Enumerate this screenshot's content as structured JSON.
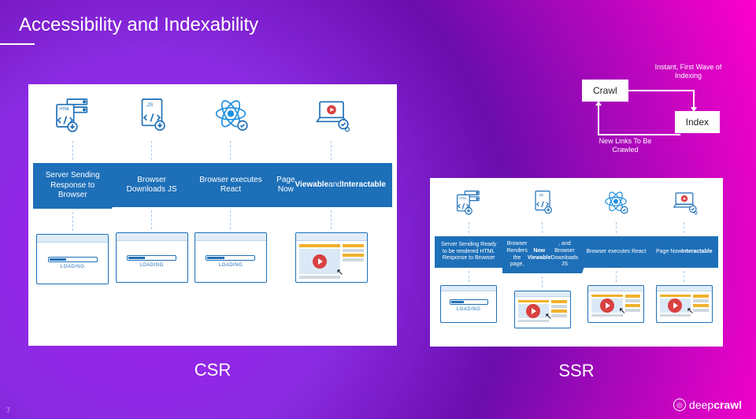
{
  "slide": {
    "title": "Accessibility and Indexability",
    "number": "7"
  },
  "brand": {
    "name_light": "deep",
    "name_bold": "crawl"
  },
  "crawl_index": {
    "top_label": "Instant, First Wave of Indexing",
    "box_crawl": "Crawl",
    "box_index": "Index",
    "bottom_label": "New Links To Be Crawled"
  },
  "csr": {
    "label": "CSR",
    "loading_text": "LOADING",
    "steps": [
      {
        "html": "Server Sending Response to Browser"
      },
      {
        "html": "Browser Downloads JS"
      },
      {
        "html": "Browser executes React"
      },
      {
        "html": "Page Now <b>Viewable</b> and <b>Interactable</b>"
      }
    ],
    "icons": [
      "html-doc",
      "js-doc",
      "react",
      "laptop"
    ],
    "bottoms": [
      "loading",
      "loading",
      "loading",
      "rich"
    ]
  },
  "ssr": {
    "label": "SSR",
    "loading_text": "LOADING",
    "steps": [
      {
        "html": "Server Sending Ready to be rendered HTML Response to Browser"
      },
      {
        "html": "Browser Renders the page, <b>Now Viewable</b>, and Browser Downloads JS"
      },
      {
        "html": "Browser executes React"
      },
      {
        "html": "Page Now <b>Interactable</b>"
      }
    ],
    "icons": [
      "html-doc",
      "js-doc",
      "react",
      "laptop"
    ],
    "bottoms": [
      "loading",
      "rich",
      "rich",
      "rich"
    ]
  }
}
